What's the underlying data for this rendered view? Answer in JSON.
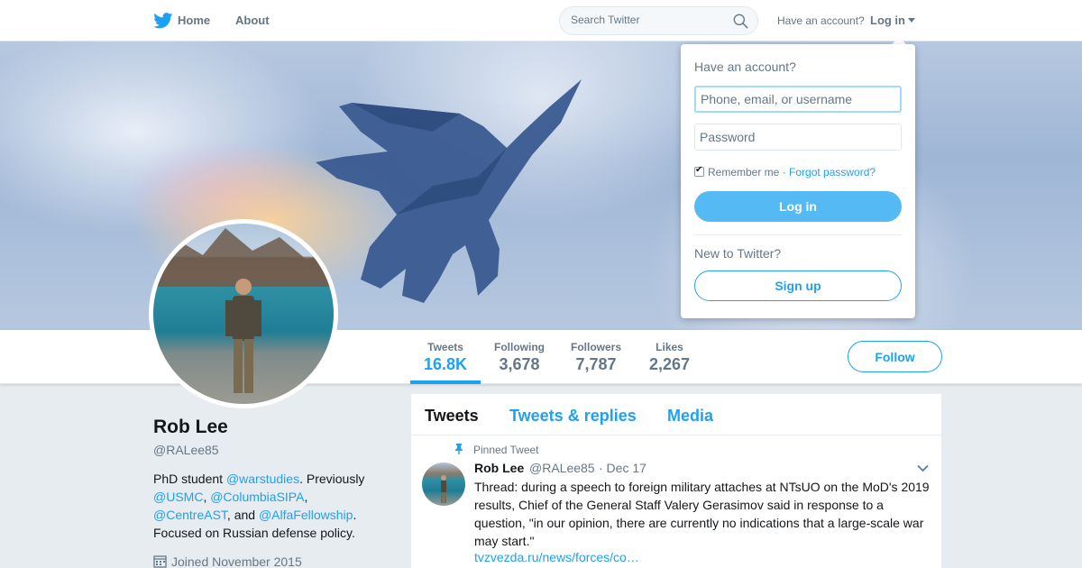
{
  "nav": {
    "home": "Home",
    "about": "About",
    "search_placeholder": "Search Twitter",
    "have_account": "Have an account?",
    "login": "Log in"
  },
  "profile": {
    "name": "Rob Lee",
    "handle": "@RALee85",
    "bio": {
      "t1": "PhD student ",
      "l1": "@warstudies",
      "t2": ". Previously ",
      "l2": "@USMC",
      "t3": ", ",
      "l3": "@ColumbiaSIPA",
      "t4": ", ",
      "l4": "@CentreAST",
      "t5": ", and ",
      "l5": "@AlfaFellowship",
      "t6": ". Focused on Russian defense policy."
    },
    "joined": "Joined November 2015"
  },
  "stats": [
    {
      "label": "Tweets",
      "value": "16.8K"
    },
    {
      "label": "Following",
      "value": "3,678"
    },
    {
      "label": "Followers",
      "value": "7,787"
    },
    {
      "label": "Likes",
      "value": "2,267"
    }
  ],
  "follow_label": "Follow",
  "timeline": {
    "tabs": [
      "Tweets",
      "Tweets & replies",
      "Media"
    ],
    "pinned_label": "Pinned Tweet",
    "tweet": {
      "name": "Rob Lee",
      "handle": "@RALee85",
      "date": "· Dec 17",
      "text": "Thread: during a speech to foreign military attaches at NTsUO on the MoD's 2019 results, Chief of the General Staff Valery Gerasimov said in response to a question, \"in our opinion, there are currently no indications that a large-scale war may start.\"",
      "link": "tvzvezda.ru/news/forces/co…"
    }
  },
  "login_dropdown": {
    "title": "Have an account?",
    "username_placeholder": "Phone, email, or username",
    "password_placeholder": "Password",
    "remember": "Remember me",
    "separator": " · ",
    "forgot": "Forgot password?",
    "login_button": "Log in",
    "new_to_twitter": "New to Twitter?",
    "signup_button": "Sign up"
  },
  "colors": {
    "accent": "#1da1f2",
    "login_button": "#55b9f3",
    "background": "#e6ecf0"
  }
}
